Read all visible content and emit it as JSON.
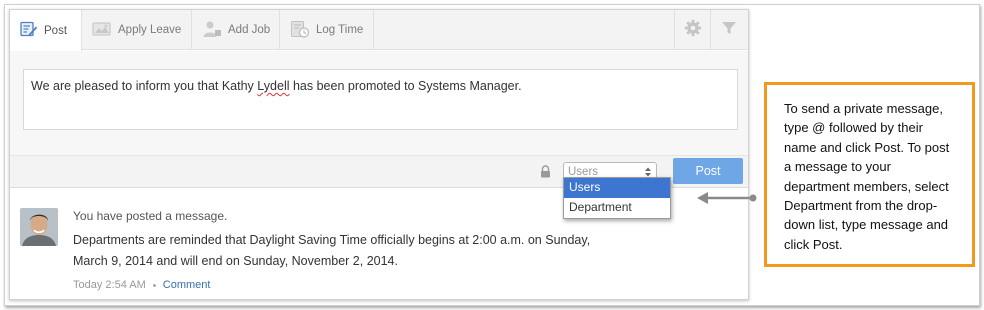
{
  "tabs": [
    {
      "label": "Post",
      "icon": "post-edit-icon"
    },
    {
      "label": "Apply Leave",
      "icon": "leave-icon"
    },
    {
      "label": "Add Job",
      "icon": "add-job-icon"
    },
    {
      "label": "Log Time",
      "icon": "log-time-icon"
    }
  ],
  "toolbar_icons": [
    "gear-icon",
    "filter-icon"
  ],
  "compose": {
    "message_before": "We are pleased to inform you that Kathy ",
    "message_misspelled": "Lydell",
    "message_after": " has been promoted to Systems Manager."
  },
  "audience_select": {
    "value": "Users",
    "options": [
      "Users",
      "Department"
    ],
    "highlighted": "Users"
  },
  "post_button": "Post",
  "feed_item": {
    "title": "You have posted a message.",
    "body": "Departments are reminded that Daylight Saving Time officially begins at 2:00 a.m. on Sunday, March 9, 2014 and will end on Sunday, November 2, 2014.",
    "time": "Today 2:54 AM",
    "comment_link": "Comment"
  },
  "callout": {
    "text": "To send a private message, type @ followed by their name and click Post. To post a message to your department members, select Department from the drop-down list, type message and click Post."
  },
  "colors": {
    "accent": "#6fa6e6",
    "highlight": "#3d76d0",
    "callout_border": "#f39a1d",
    "link": "#3a6fb0"
  }
}
